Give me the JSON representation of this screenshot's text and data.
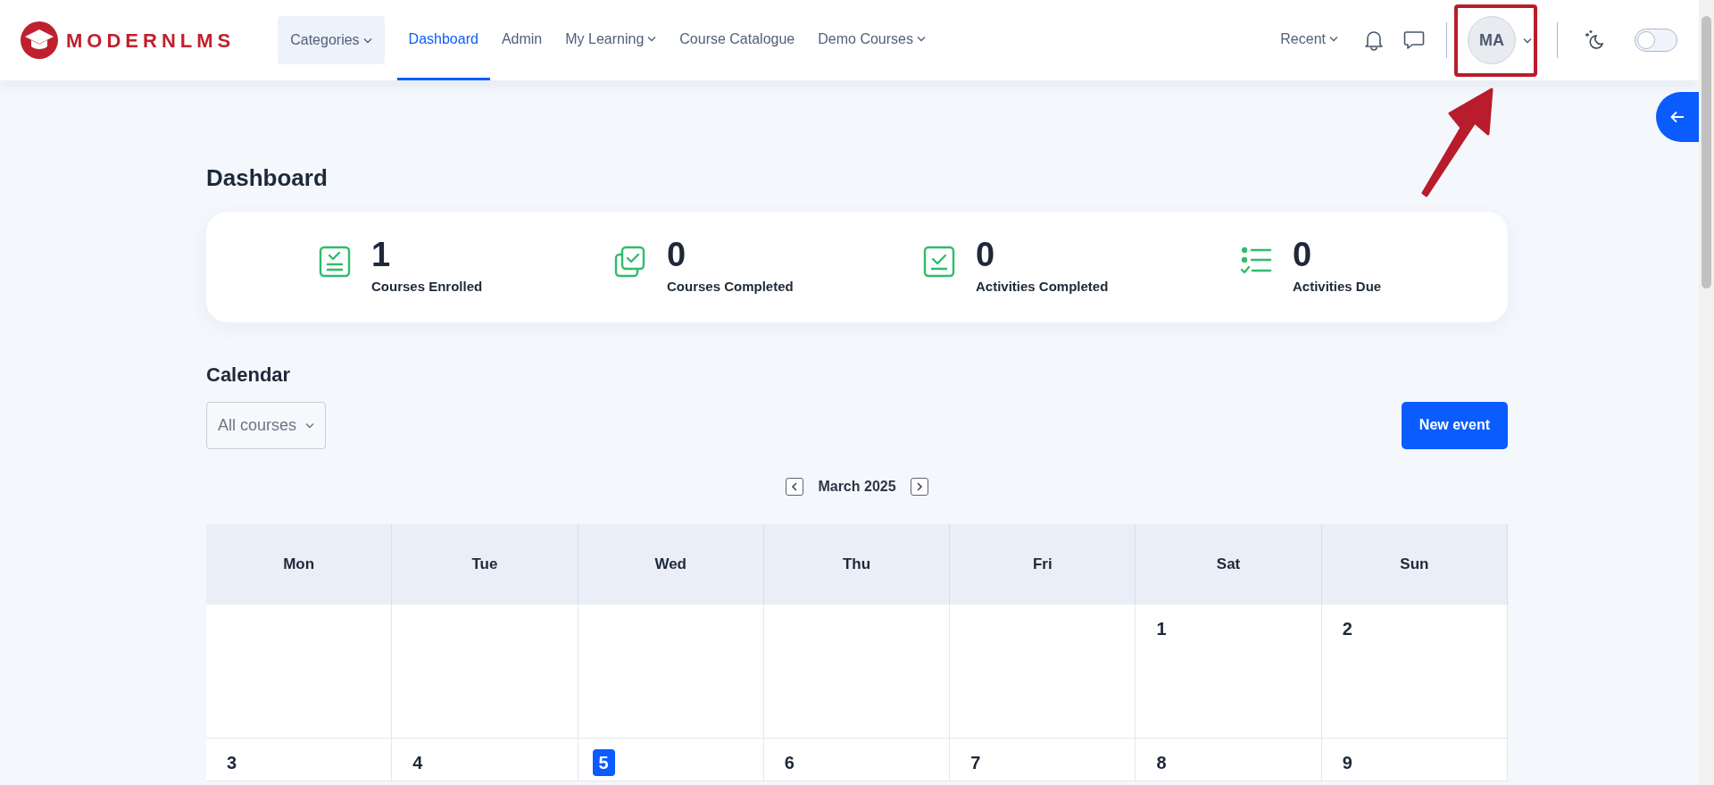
{
  "navbar": {
    "logo_text": "MODERNLMS",
    "nav_items": [
      {
        "label": "Categories",
        "kind": "menu-button",
        "dropdown": true,
        "selected": false
      },
      {
        "label": "Dashboard",
        "kind": "link",
        "dropdown": false,
        "selected": true
      },
      {
        "label": "Admin",
        "kind": "link",
        "dropdown": false,
        "selected": false
      },
      {
        "label": "My Learning",
        "kind": "link",
        "dropdown": true,
        "selected": false
      },
      {
        "label": "Course Catalogue",
        "kind": "link",
        "dropdown": false,
        "selected": false
      },
      {
        "label": "Demo Courses",
        "kind": "link",
        "dropdown": true,
        "selected": false
      }
    ],
    "recent": "Recent",
    "avatar_initials": "MA",
    "dark_mode": {
      "on": false
    }
  },
  "page_title": "Dashboard",
  "stats": [
    {
      "kind": "enrolled",
      "value": "1",
      "label": "Courses Enrolled"
    },
    {
      "kind": "courses-completed",
      "value": "0",
      "label": "Courses Completed"
    },
    {
      "kind": "activities-completed",
      "value": "0",
      "label": "Activities Completed"
    },
    {
      "kind": "due",
      "value": "0",
      "label": "Activities Due"
    }
  ],
  "calendar": {
    "title": "Calendar",
    "filter": "All courses",
    "new_button": "New event",
    "month": "March 2025",
    "weekdays": [
      "Mon",
      "Tue",
      "Wed",
      "Thu",
      "Fri",
      "Sat",
      "Sun"
    ],
    "weeks": [
      [
        {
          "kind": "blank"
        },
        {
          "kind": "blank"
        },
        {
          "kind": "blank"
        },
        {
          "kind": "blank"
        },
        {
          "kind": "blank"
        },
        {
          "kind": "day",
          "day": "1",
          "today": false
        },
        {
          "kind": "day",
          "day": "2",
          "today": false
        }
      ],
      [
        {
          "kind": "day",
          "day": "3",
          "today": false
        },
        {
          "kind": "day",
          "day": "4",
          "today": false
        },
        {
          "kind": "day",
          "day": "5",
          "today": true
        },
        {
          "kind": "day",
          "day": "6",
          "today": false
        },
        {
          "kind": "day",
          "day": "7",
          "today": false
        },
        {
          "kind": "day",
          "day": "8",
          "today": false
        },
        {
          "kind": "day",
          "day": "9",
          "today": false
        }
      ]
    ]
  }
}
